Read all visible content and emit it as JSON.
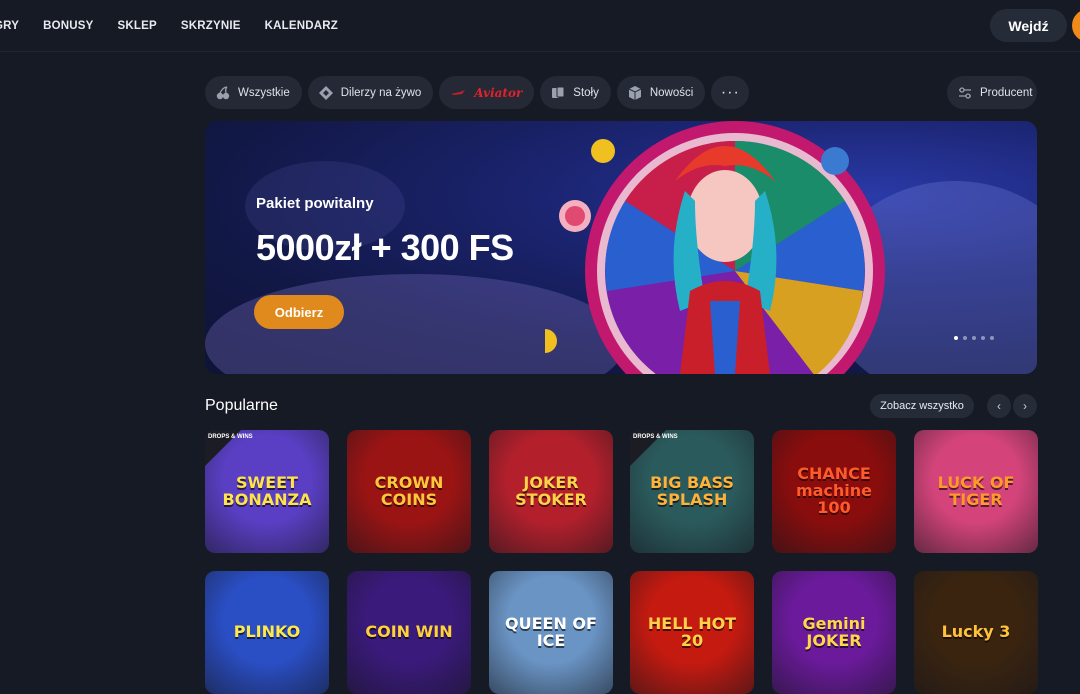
{
  "nav": {
    "items": [
      "GRY",
      "BONUSY",
      "SKLEP",
      "SKRZYNIE",
      "KALENDARZ"
    ],
    "login_label": "Wejdź"
  },
  "filters": {
    "chips": [
      {
        "label": "Wszystkie",
        "icon": "cherries-icon"
      },
      {
        "label": "Dilerzy na żywo",
        "icon": "diamond-chip-icon"
      },
      {
        "label": "Aviator",
        "icon": "plane-icon"
      },
      {
        "label": "Stoły",
        "icon": "cards-icon"
      },
      {
        "label": "Nowości",
        "icon": "cube-icon"
      }
    ],
    "more_label": "···",
    "producer_label": "Producent"
  },
  "banner": {
    "subtitle": "Pakiet powitalny",
    "title": "5000zł + 300 FS",
    "button_label": "Odbierz",
    "slide_count": 5,
    "active_slide": 1
  },
  "popular": {
    "title": "Popularne",
    "see_all_label": "Zobacz wszystko",
    "prev_label": "‹",
    "next_label": "›",
    "drops_label": "DROPS & WINS",
    "games": [
      {
        "name": "SWEET BONANZA",
        "bg": "#5a3fc4",
        "fg": "#ffe34a",
        "drops": true
      },
      {
        "name": "CROWN COINS",
        "bg": "#9b1414",
        "fg": "#ffc83a",
        "drops": false
      },
      {
        "name": "JOKER STOKER",
        "bg": "#b3202c",
        "fg": "#ffd24a",
        "drops": false
      },
      {
        "name": "BIG BASS SPLASH",
        "bg": "#2b5a5c",
        "fg": "#ffb23a",
        "drops": true
      },
      {
        "name": "CHANCE machine 100",
        "bg": "#8a0d0d",
        "fg": "#ff5a2a",
        "drops": false
      },
      {
        "name": "LUCK OF TIGER",
        "bg": "#d4447a",
        "fg": "#ff9a2a",
        "drops": false
      },
      {
        "name": "PLINKO",
        "bg": "#2a4ec4",
        "fg": "#ffe94a",
        "drops": false
      },
      {
        "name": "COIN WIN",
        "bg": "#3a1a7a",
        "fg": "#ffd23a",
        "drops": false
      },
      {
        "name": "QUEEN OF ICE",
        "bg": "#6a94c4",
        "fg": "#ffffff",
        "drops": false
      },
      {
        "name": "HELL HOT 20",
        "bg": "#c41a10",
        "fg": "#ffd24a",
        "drops": false
      },
      {
        "name": "Gemini JOKER",
        "bg": "#6a1a9a",
        "fg": "#ffd84a",
        "drops": false
      },
      {
        "name": "Lucky 3",
        "bg": "#3a2410",
        "fg": "#ffc23a",
        "drops": false
      }
    ]
  },
  "colors": {
    "background": "#161a24",
    "chip": "#242935",
    "accent": "#e08a1e"
  }
}
